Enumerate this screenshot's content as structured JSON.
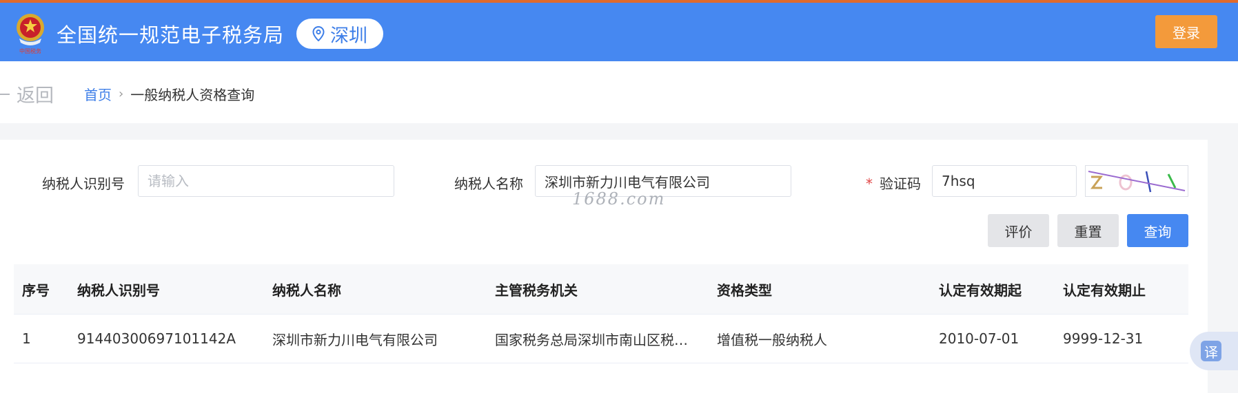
{
  "header": {
    "title": "全国统一规范电子税务局",
    "city": "深圳",
    "login_label": "登录",
    "emblem_text": "中国税务",
    "emblem": "tax-emblem",
    "location_icon": "location-pin-icon",
    "colors": {
      "bar": "#4688f1",
      "login": "#f39a3b",
      "accent_line": "#e06a2c"
    }
  },
  "nav": {
    "back_label": "返回",
    "breadcrumb": {
      "home": "首页",
      "separator": "›",
      "current": "一般纳税人资格查询"
    }
  },
  "form": {
    "taxpayer_id": {
      "label": "纳税人识别号",
      "placeholder": "请输入",
      "value": ""
    },
    "taxpayer_name": {
      "label": "纳税人名称",
      "value": "深圳市新力川电气有限公司"
    },
    "captcha": {
      "required_mark": "*",
      "label": "验证码",
      "value": "7hsq"
    },
    "buttons": {
      "evaluate": "评价",
      "reset": "重置",
      "query": "查询"
    },
    "watermark": "1688.com"
  },
  "table": {
    "headers": [
      "序号",
      "纳税人识别号",
      "纳税人名称",
      "主管税务机关",
      "资格类型",
      "认定有效期起",
      "认定有效期止"
    ],
    "rows": [
      [
        "1",
        "91440300697101142A",
        "深圳市新力川电气有限公司",
        "国家税务总局深圳市南山区税…",
        "增值税一般纳税人",
        "2010-07-01",
        "9999-12-31"
      ]
    ]
  },
  "translate": {
    "label": "译",
    "icon": "translate-icon"
  }
}
